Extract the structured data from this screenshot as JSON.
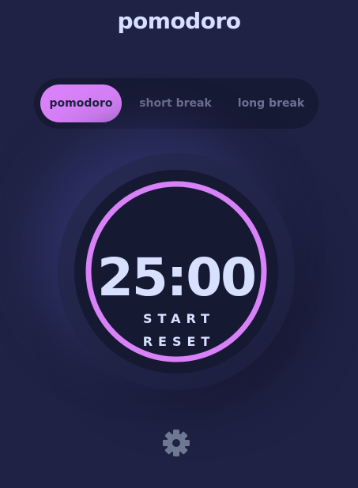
{
  "app": {
    "title": "pomodoro"
  },
  "modes": {
    "tabs": [
      {
        "label": "pomodoro",
        "active": true
      },
      {
        "label": "short break",
        "active": false
      },
      {
        "label": "long break",
        "active": false
      }
    ]
  },
  "timer": {
    "time": "25:00",
    "progress": 1.0,
    "start_label": "START",
    "reset_label": "RESET"
  },
  "icons": {
    "settings": "gear-icon"
  },
  "colors": {
    "background": "#1f2244",
    "panel": "#171a34",
    "accent": "#d881f8",
    "text": "#d7e0ff",
    "muted": "#6e7193",
    "settings_icon": "#6d7990"
  }
}
